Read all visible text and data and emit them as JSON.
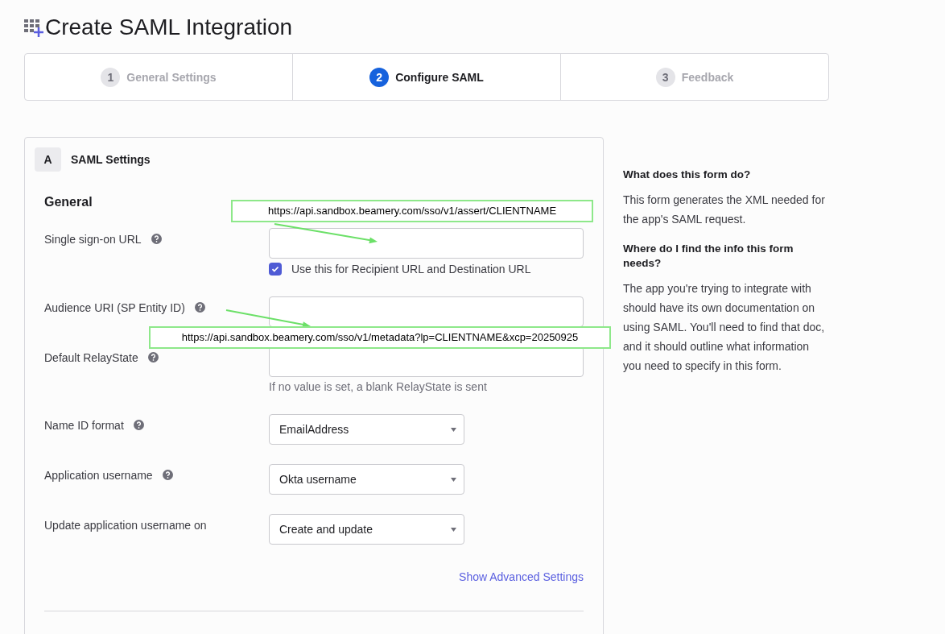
{
  "page_title": "Create SAML Integration",
  "steps": [
    {
      "number": "1",
      "label": "General Settings",
      "selected": false
    },
    {
      "number": "2",
      "label": "Configure SAML",
      "selected": true
    },
    {
      "number": "3",
      "label": "Feedback",
      "selected": false
    }
  ],
  "section": {
    "badge": "A",
    "title": "SAML Settings"
  },
  "group_heading": "General",
  "fields": [
    {
      "kind": "text",
      "label": "Single sign-on URL",
      "help": true,
      "checkbox": {
        "label": "Use this for Recipient URL and Destination URL",
        "checked": true
      }
    },
    {
      "kind": "text",
      "label": "Audience URI (SP Entity ID)",
      "help": true
    },
    {
      "kind": "text",
      "label": "Default RelayState",
      "help": true,
      "hint": "If no value is set, a blank RelayState is sent"
    },
    {
      "kind": "select",
      "label": "Name ID format",
      "help": true,
      "value": "EmailAddress"
    },
    {
      "kind": "select",
      "label": "Application username",
      "help": true,
      "value": "Okta username"
    },
    {
      "kind": "select",
      "label": "Update application username on",
      "help": false,
      "value": "Create and update"
    }
  ],
  "advanced_link": "Show Advanced Settings",
  "callouts": [
    {
      "text": "https://api.sandbox.beamery.com/sso/v1/assert/CLIENTNAME"
    },
    {
      "text": "https://api.sandbox.beamery.com/sso/v1/metadata?lp=CLIENTNAME&xcp=20250925"
    }
  ],
  "help_panel": [
    {
      "heading": "What does this form do?",
      "body": "This form generates the XML needed for the app's SAML request."
    },
    {
      "heading": "Where do I find the info this form needs?",
      "body": "The app you're trying to integrate with should have its own documentation on using SAML. You'll need to find that doc, and it should outline what information you need to specify in this form."
    }
  ]
}
